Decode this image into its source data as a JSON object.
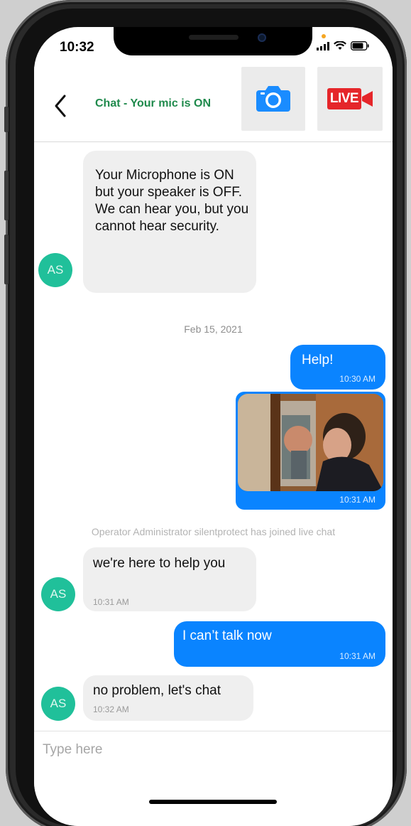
{
  "status_bar": {
    "time": "10:32"
  },
  "header": {
    "title": "Chat - Your mic is ON",
    "live_label": "LIVE"
  },
  "messages": {
    "m1": {
      "text": "Your Microphone is ON but your speaker is OFF. We can hear you, but you cannot hear security.",
      "avatar": "AS"
    },
    "date_separator": "Feb 15, 2021",
    "m2": {
      "text": "Help!",
      "time": "10:30 AM"
    },
    "m3": {
      "time": "10:31 AM"
    },
    "system": "Operator Administrator silentprotect has joined live chat",
    "m4": {
      "text": "we're here to help you",
      "time": "10:31 AM",
      "avatar": "AS"
    },
    "m5": {
      "text": "I can’t talk now",
      "time": "10:31 AM"
    },
    "m6": {
      "text": "no problem, let's chat",
      "time": "10:32 AM",
      "avatar": "AS"
    }
  },
  "input": {
    "placeholder": "Type here"
  },
  "colors": {
    "accent_blue": "#0a84ff",
    "title_green": "#1f8a4c",
    "avatar_teal": "#20c09a",
    "live_red": "#e5262a"
  }
}
